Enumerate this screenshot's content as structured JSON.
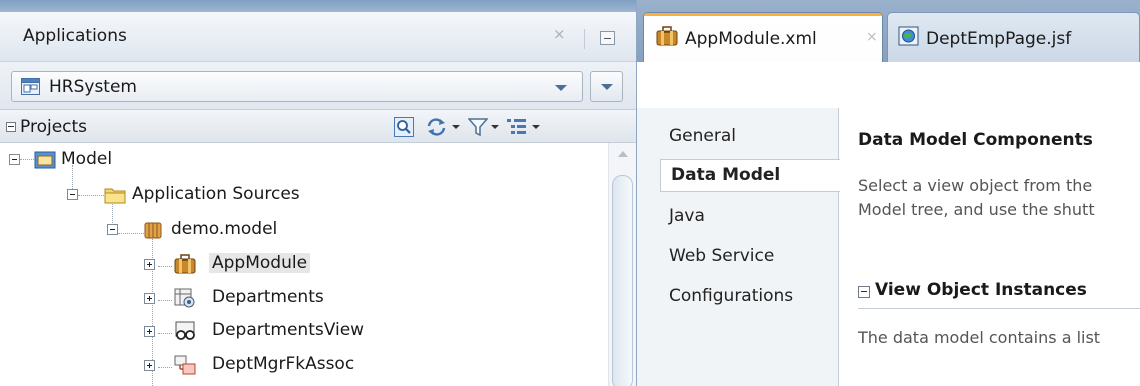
{
  "applications_panel": {
    "title": "Applications",
    "close_glyph": "×",
    "application_selector": {
      "value": "HRSystem",
      "icon": "application-icon"
    }
  },
  "projects_panel": {
    "title": "Projects",
    "toolbar_icons": [
      "find-icon",
      "sync-icon",
      "filter-icon",
      "working-sets-icon"
    ]
  },
  "tree": {
    "nodes": [
      {
        "label": "Model",
        "icon": "project-icon",
        "expanded": true
      },
      {
        "label": "Application Sources",
        "icon": "folder-icon",
        "expanded": true
      },
      {
        "label": "demo.model",
        "icon": "package-icon",
        "expanded": true
      },
      {
        "label": "AppModule",
        "icon": "application-module-icon",
        "expanded": false,
        "selected": true
      },
      {
        "label": "Departments",
        "icon": "entity-object-icon",
        "expanded": false
      },
      {
        "label": "DepartmentsView",
        "icon": "view-object-icon",
        "expanded": false
      },
      {
        "label": "DeptMgrFkAssoc",
        "icon": "association-icon",
        "expanded": false
      }
    ]
  },
  "editor_tabs": [
    {
      "label": "AppModule.xml",
      "icon": "application-module-icon",
      "active": true
    },
    {
      "label": "DeptEmpPage.jsf",
      "icon": "jsf-page-icon",
      "active": false
    }
  ],
  "close_glyph": "×",
  "side_nav": {
    "items": [
      "General",
      "Data Model",
      "Java",
      "Web Service",
      "Configurations"
    ],
    "active": "Data Model"
  },
  "content": {
    "title": "Data Model Components",
    "description_line1": "Select a view object from the",
    "description_line2": "Model tree, and use the shutt",
    "section_title": "View Object Instances",
    "section_text": "The data model contains a list"
  },
  "colors": {
    "accent_tab": "#ffb03a",
    "selection": "#e6e6e6",
    "tabbar": "#8da7c4"
  }
}
